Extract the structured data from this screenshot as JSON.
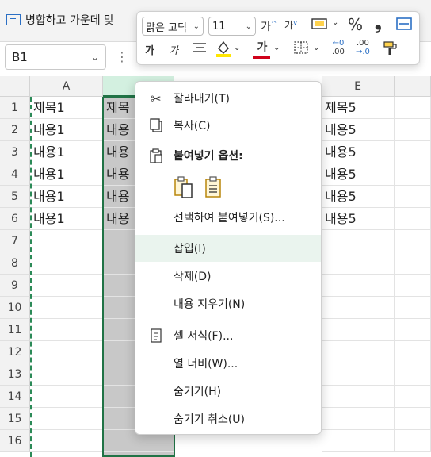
{
  "ribbon": {
    "merge_label": "병합하고 가운데 맞"
  },
  "formula_bar": {
    "name_box": "B1"
  },
  "columns": [
    "A",
    "E"
  ],
  "rows": [
    "1",
    "2",
    "3",
    "4",
    "5",
    "6",
    "7",
    "8",
    "9",
    "10",
    "11",
    "12",
    "13",
    "14",
    "15",
    "16"
  ],
  "cells": {
    "A": [
      "제목1",
      "내용1",
      "내용1",
      "내용1",
      "내용1",
      "내용1"
    ],
    "B": [
      "제목",
      "내용",
      "내용",
      "내용",
      "내용",
      "내용"
    ],
    "E": [
      "제목5",
      "내용5",
      "내용5",
      "내용5",
      "내용5",
      "내용5"
    ]
  },
  "mini_toolbar": {
    "font_name": "맑은 고딕",
    "font_size": "11",
    "grow_font": "가",
    "shrink_font": "가",
    "percent": "%",
    "comma": "❟",
    "bold": "가",
    "italic": "가",
    "font_color": "가",
    "inc_decimal_top": "←0",
    "inc_decimal_bottom": ".00",
    "dec_decimal_top": ".00",
    "dec_decimal_bottom": "→.0"
  },
  "context_menu": {
    "cut": "잘라내기(T)",
    "copy": "복사(C)",
    "paste_options": "붙여넣기 옵션:",
    "paste_special": "선택하여 붙여넣기(S)...",
    "insert": "삽입(I)",
    "delete": "삭제(D)",
    "clear": "내용 지우기(N)",
    "format_cells": "셀 서식(F)...",
    "column_width": "열 너비(W)...",
    "hide": "숨기기(H)",
    "unhide": "숨기기 취소(U)"
  },
  "colors": {
    "accent": "#217346",
    "selection": "#c8c8c8",
    "highlight": "#eaf4ee",
    "font_red": "#d0021b",
    "fill_yellow": "#ffe600"
  }
}
